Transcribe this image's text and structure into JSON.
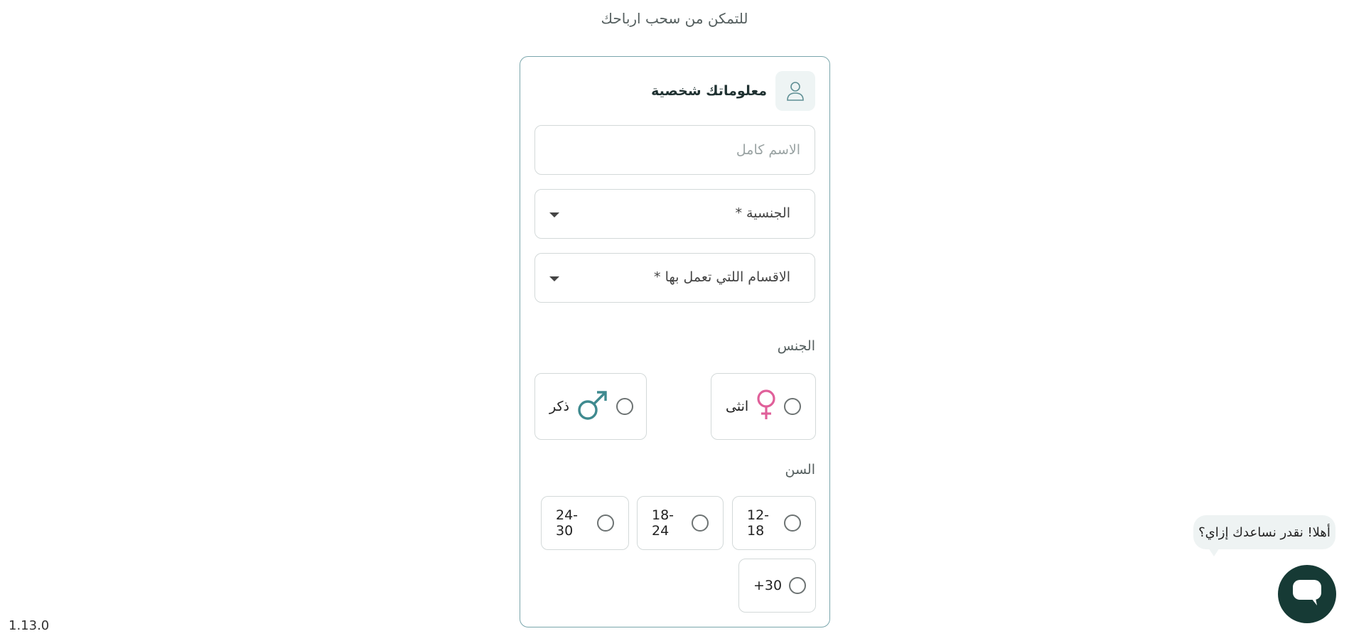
{
  "header": {
    "subtitle": "للتمكن من سحب ارباحك"
  },
  "card": {
    "title": "معلوماتك شخصية",
    "icon": "user-icon"
  },
  "form": {
    "full_name": {
      "placeholder": "الاسم كامل",
      "value": ""
    },
    "nationality": {
      "label": "الجنسية *"
    },
    "departments": {
      "label": "الاقسام اللتي تعمل بها *"
    },
    "gender": {
      "label": "الجنس",
      "options": [
        {
          "label": "انثى",
          "icon": "female-symbol-icon",
          "color": "#e0609a"
        },
        {
          "label": "ذكر",
          "icon": "male-symbol-icon",
          "color": "#3f8a8f"
        }
      ]
    },
    "age": {
      "label": "السن",
      "options": [
        "12-18",
        "18-24",
        "24-30",
        "+30"
      ]
    }
  },
  "footer": {
    "version": "1.13.0"
  },
  "chat": {
    "greeting": "أهلا! نقدر نساعدك إزاي؟",
    "icon": "chat-icon"
  },
  "colors": {
    "accent": "#163a35",
    "card_border": "#7aa6ac",
    "male": "#3f8a8f",
    "female": "#e0609a"
  }
}
